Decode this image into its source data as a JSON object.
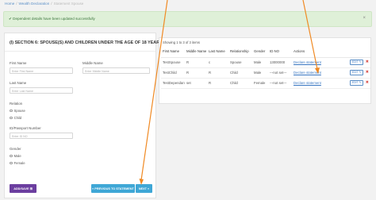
{
  "breadcrumb": {
    "home": "Home",
    "wealth": "Wealth Declaration",
    "current": "Statement Spouse"
  },
  "alert": {
    "message": "Dependent details have been updated successfully",
    "close": "×"
  },
  "form": {
    "section_title": "(I) SECTION 6: SPOUSE(S) AND CHILDREN UNDER THE AGE OF 18 YEARS",
    "first_name": {
      "label": "First Name",
      "placeholder": "Enter First Name"
    },
    "middle_name": {
      "label": "Middle Name",
      "placeholder": "Enter Middle Name"
    },
    "last_name": {
      "label": "Last Name",
      "placeholder": "Enter Last Name"
    },
    "relation": {
      "label": "Relation",
      "options": [
        "Spouse",
        "Child"
      ]
    },
    "id_passport": {
      "label": "ID/Passport Number",
      "placeholder": "Enter ID NO"
    },
    "gender": {
      "label": "Gender",
      "options": [
        "Male",
        "Female"
      ]
    },
    "buttons": {
      "add_save": "ADD/SAVE ⊞",
      "previous": "« PREVIOUS TO STATEMENT",
      "next": "NEXT »"
    }
  },
  "table": {
    "showing": "Showing 1 to 3 of 3 items",
    "headers": [
      "First Name",
      "Middle Name",
      "Last Name",
      "Relationship",
      "Gender",
      "ID NO",
      "Actions"
    ],
    "rows": [
      {
        "first": "TestSpouse",
        "middle": "R",
        "last": "c",
        "relationship": "Spouse",
        "gender": "Male",
        "id_no": "13000000",
        "action": "Declare statement",
        "edit": "EDIT ✎",
        "delete": "✖"
      },
      {
        "first": "TestChild",
        "middle": "R",
        "last": "R",
        "relationship": "Child",
        "gender": "Male",
        "id_no": "---not set---",
        "action": "Declare statement",
        "edit": "EDIT ✎",
        "delete": "✖"
      },
      {
        "first": "TestDependant",
        "middle": "set",
        "last": "R",
        "relationship": "Child",
        "gender": "Female",
        "id_no": "---not set---",
        "action": "Declare statement",
        "edit": "EDIT ✎",
        "delete": "✖"
      }
    ]
  },
  "colors": {
    "annotation_arrow": "#f08a24",
    "success_bg": "#dff0d8",
    "purple_button": "#6b3e9f",
    "cyan_button": "#3fa7d6"
  }
}
